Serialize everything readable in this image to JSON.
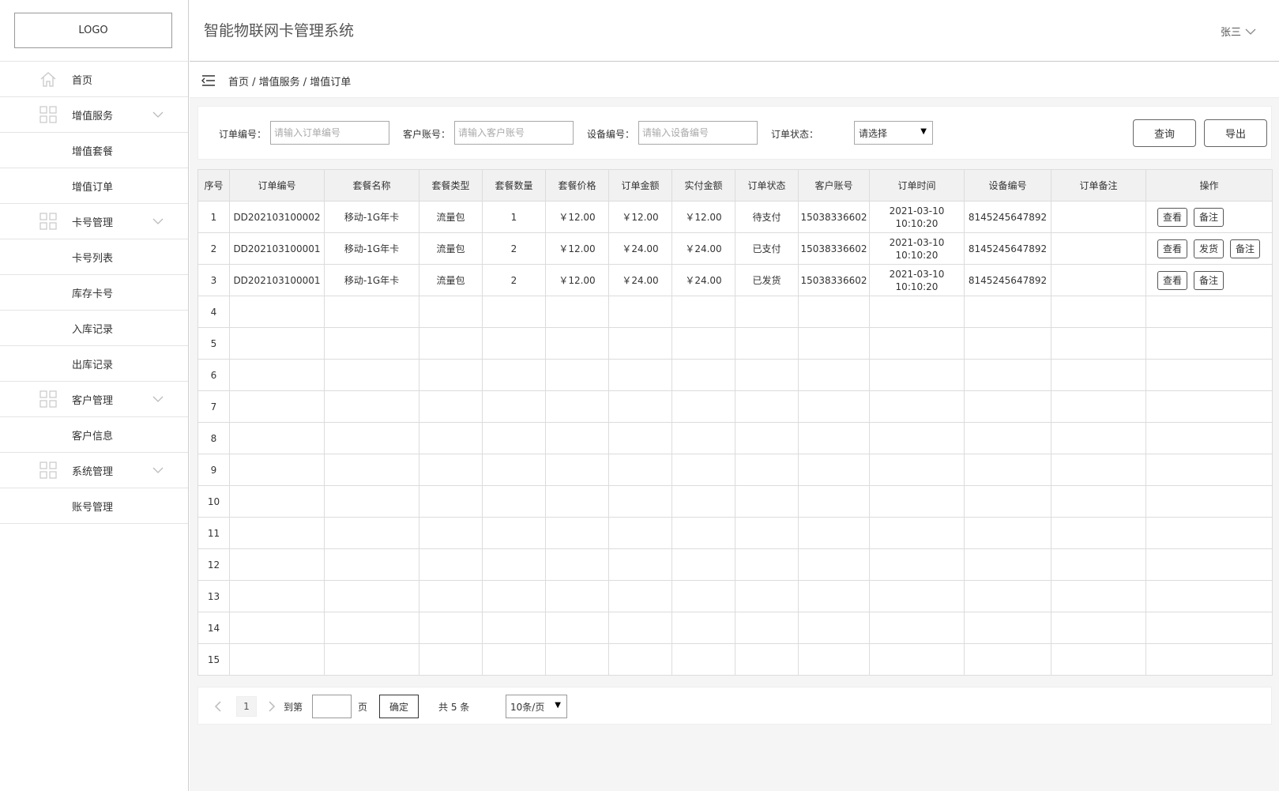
{
  "logo": "LOGO",
  "app_title": "智能物联网卡管理系统",
  "user": {
    "name": "张三"
  },
  "sidebar": {
    "items": [
      {
        "label": "首页",
        "type": "top",
        "icon": "home-icon"
      },
      {
        "label": "增值服务",
        "type": "group",
        "icon": "grid-icon"
      },
      {
        "label": "增值套餐",
        "type": "sub"
      },
      {
        "label": "增值订单",
        "type": "sub"
      },
      {
        "label": "卡号管理",
        "type": "group",
        "icon": "grid-icon"
      },
      {
        "label": "卡号列表",
        "type": "sub"
      },
      {
        "label": "库存卡号",
        "type": "sub"
      },
      {
        "label": "入库记录",
        "type": "sub"
      },
      {
        "label": "出库记录",
        "type": "sub"
      },
      {
        "label": "客户管理",
        "type": "group",
        "icon": "grid-icon"
      },
      {
        "label": "客户信息",
        "type": "sub"
      },
      {
        "label": "系统管理",
        "type": "group",
        "icon": "grid-icon"
      },
      {
        "label": "账号管理",
        "type": "sub"
      }
    ]
  },
  "breadcrumb": "首页 / 增值服务 / 增值订单",
  "filters": {
    "order_no_label": "订单编号：",
    "order_no_placeholder": "请输入订单编号",
    "customer_label": "客户账号：",
    "customer_placeholder": "请输入客户账号",
    "device_label": "设备编号：",
    "device_placeholder": "请输入设备编号",
    "status_label": "订单状态：",
    "status_value": "请选择",
    "query_button": "查询",
    "export_button": "导出"
  },
  "table": {
    "columns": [
      "序号",
      "订单编号",
      "套餐名称",
      "套餐类型",
      "套餐数量",
      "套餐价格",
      "订单金额",
      "实付金额",
      "订单状态",
      "客户账号",
      "订单时间",
      "设备编号",
      "订单备注",
      "操作"
    ],
    "rows": [
      {
        "idx": "1",
        "order_no": "DD202103100002",
        "package_name": "移动-1G年卡",
        "package_type": "流量包",
        "qty": "1",
        "price": "￥12.00",
        "amount": "￥12.00",
        "paid": "￥12.00",
        "status": "待支付",
        "customer": "15038336602",
        "time_date": "2021-03-10",
        "time_clock": "10:10:20",
        "device": "8145245647892",
        "remark": "",
        "actions": [
          "查看",
          "备注"
        ]
      },
      {
        "idx": "2",
        "order_no": "DD202103100001",
        "package_name": "移动-1G年卡",
        "package_type": "流量包",
        "qty": "2",
        "price": "￥12.00",
        "amount": "￥24.00",
        "paid": "￥24.00",
        "status": "已支付",
        "customer": "15038336602",
        "time_date": "2021-03-10",
        "time_clock": "10:10:20",
        "device": "8145245647892",
        "remark": "",
        "actions": [
          "查看",
          "发货",
          "备注"
        ]
      },
      {
        "idx": "3",
        "order_no": "DD202103100001",
        "package_name": "移动-1G年卡",
        "package_type": "流量包",
        "qty": "2",
        "price": "￥12.00",
        "amount": "￥24.00",
        "paid": "￥24.00",
        "status": "已发货",
        "customer": "15038336602",
        "time_date": "2021-03-10",
        "time_clock": "10:10:20",
        "device": "8145245647892",
        "remark": "",
        "actions": [
          "查看",
          "备注"
        ]
      }
    ],
    "empty_row_numbers": [
      "4",
      "5",
      "6",
      "7",
      "8",
      "9",
      "10",
      "11",
      "12",
      "13",
      "14",
      "15"
    ]
  },
  "pagination": {
    "current_page": "1",
    "goto_label": "到第",
    "page_unit": "页",
    "confirm_button": "确定",
    "total_text": "共 5 条",
    "page_size": "10条/页"
  }
}
